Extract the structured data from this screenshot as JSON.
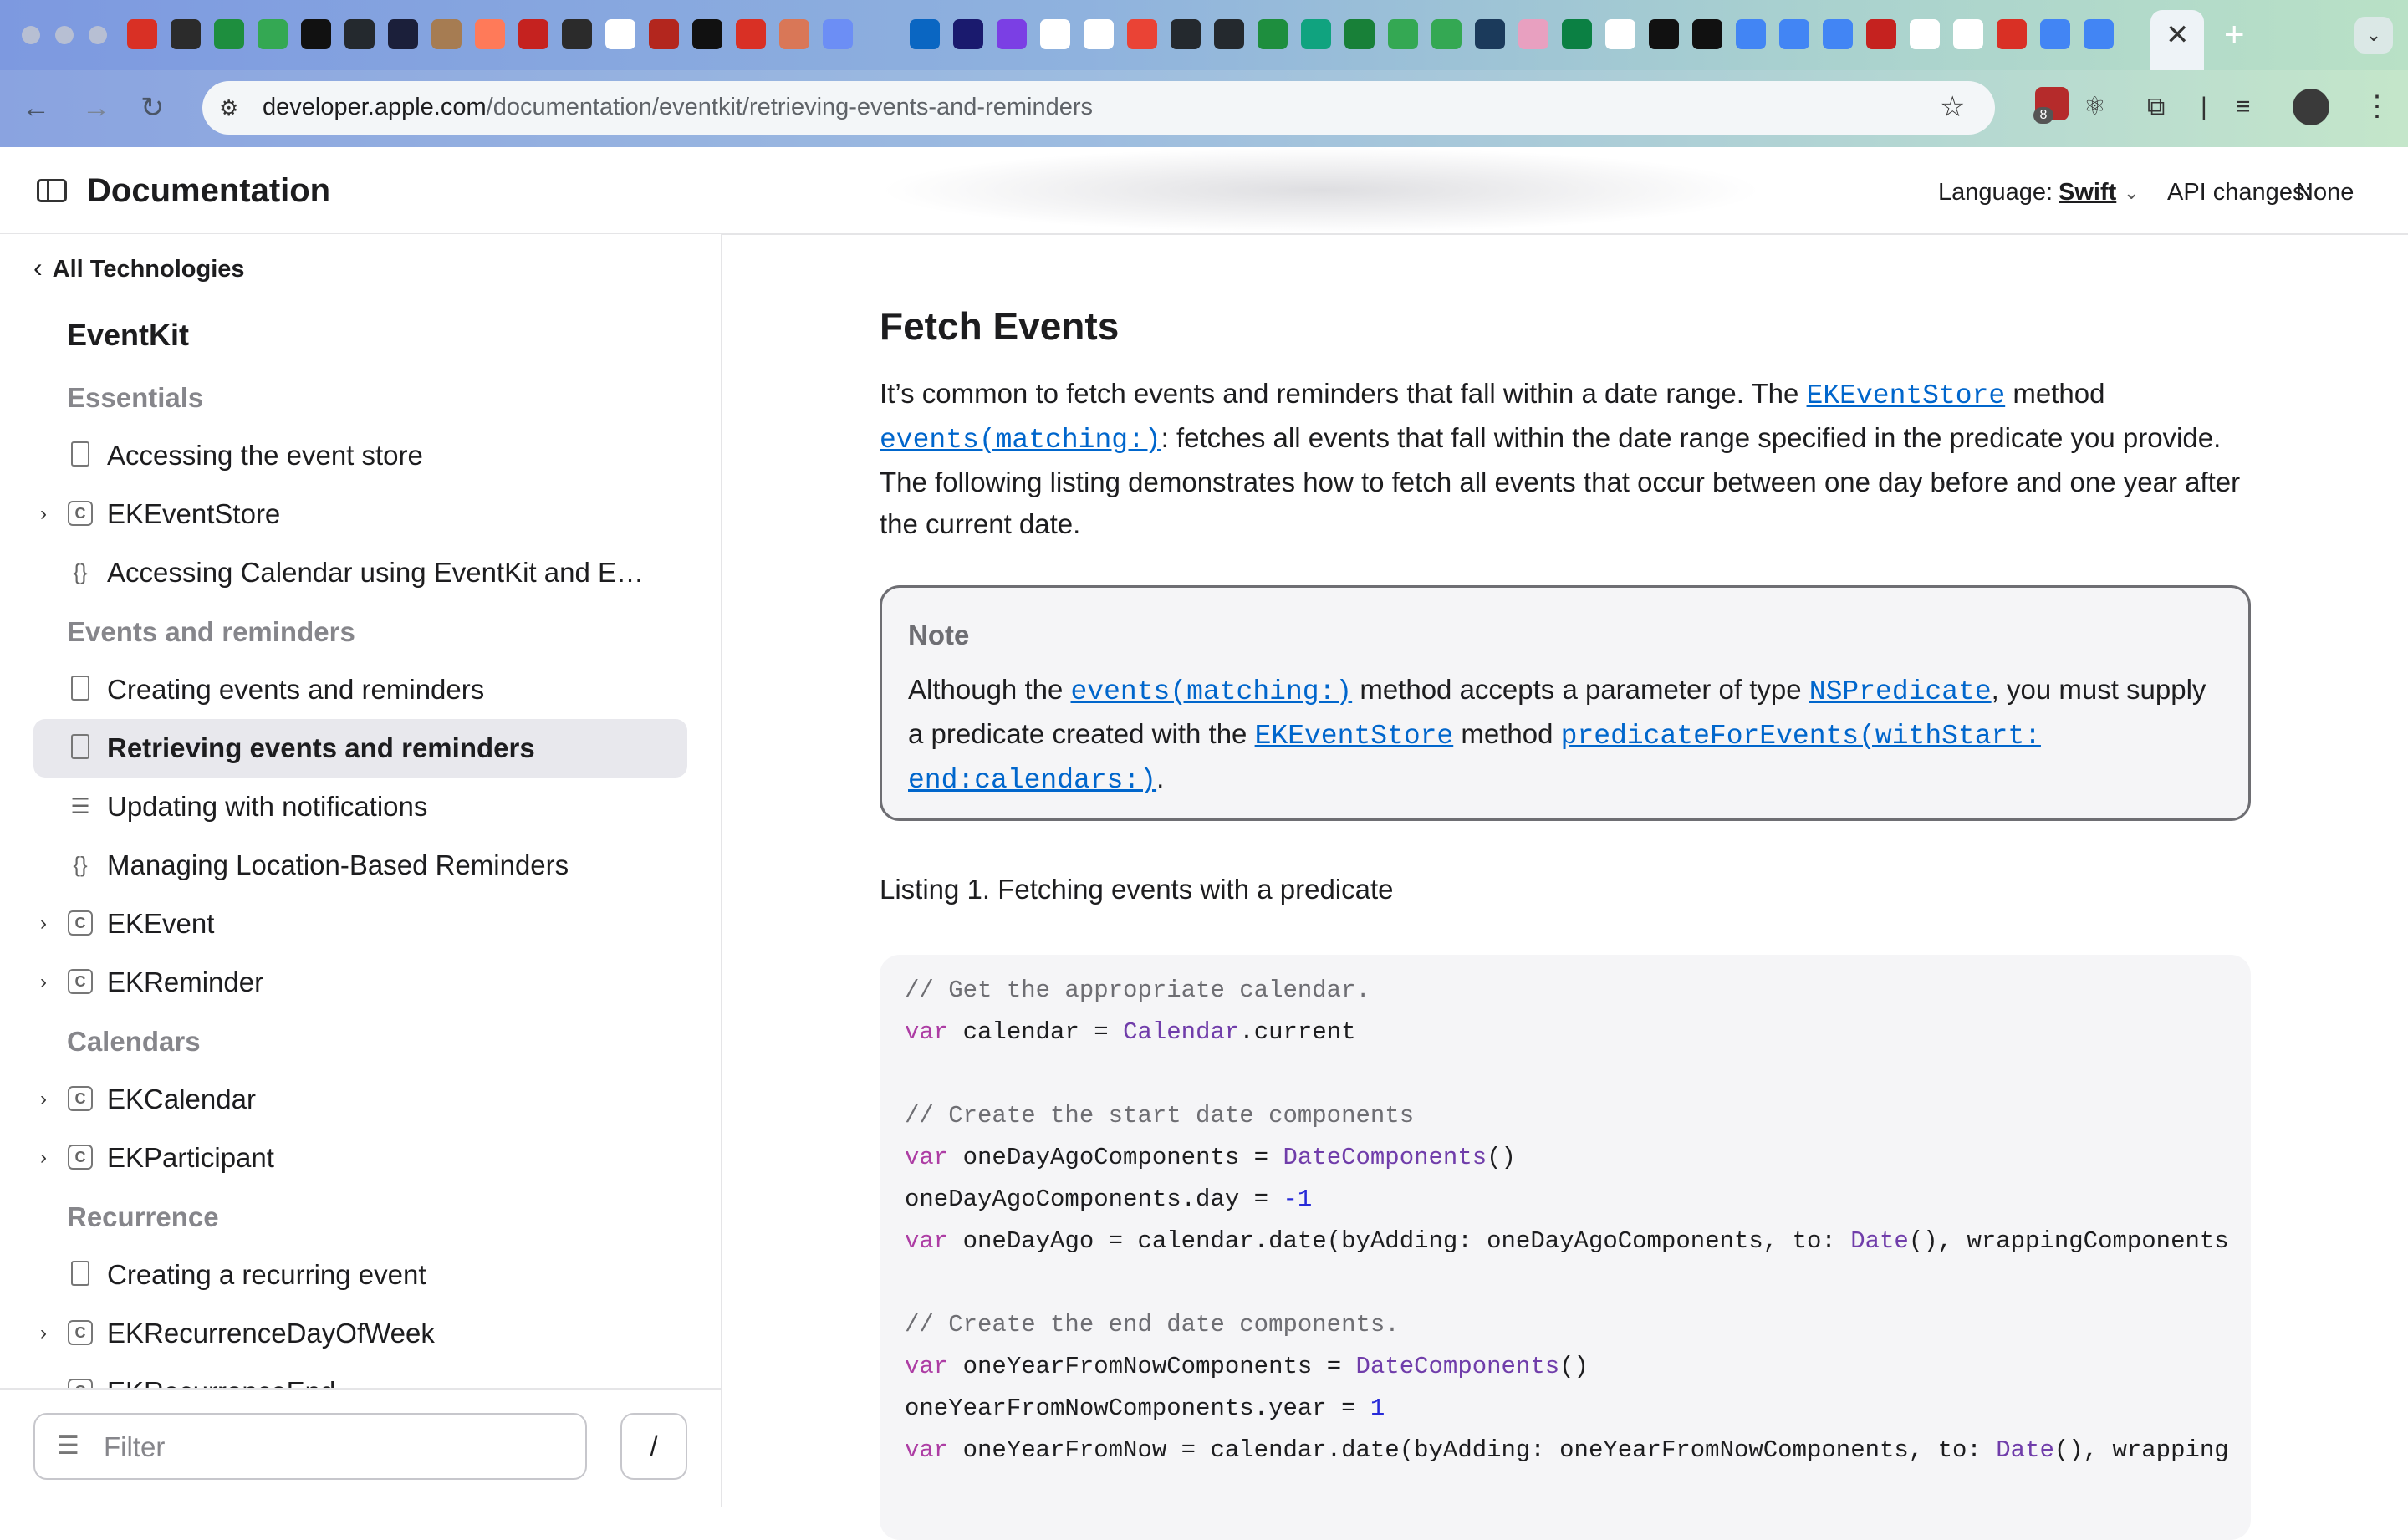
{
  "browser": {
    "url_host": "developer.apple.com",
    "url_path": "/documentation/eventkit/retrieving-events-and-reminders",
    "extension_badge_count": "8",
    "new_tab_glyph": "+",
    "close_tab_glyph": "✕"
  },
  "header": {
    "title": "Documentation",
    "language_label": "Language:",
    "language_value": "Swift",
    "api_changes_label": "API changes:",
    "api_changes_value": "None"
  },
  "sidebar": {
    "back_label": "All Technologies",
    "technology": "EventKit",
    "sections": [
      {
        "title": "Essentials"
      },
      {
        "title": "Events and reminders"
      },
      {
        "title": "Calendars"
      },
      {
        "title": "Recurrence"
      }
    ],
    "items": [
      {
        "label": "Accessing the event store",
        "icon": "article-icon"
      },
      {
        "label": "EKEventStore",
        "icon": "class-icon"
      },
      {
        "label": "Accessing Calendar using EventKit and E…",
        "icon": "sample-code-icon"
      },
      {
        "label": "Creating events and reminders",
        "icon": "article-icon"
      },
      {
        "label": "Retrieving events and reminders",
        "icon": "article-icon"
      },
      {
        "label": "Updating with notifications",
        "icon": "list-icon"
      },
      {
        "label": "Managing Location-Based Reminders",
        "icon": "sample-code-icon"
      },
      {
        "label": "EKEvent",
        "icon": "class-icon"
      },
      {
        "label": "EKReminder",
        "icon": "class-icon"
      },
      {
        "label": "EKCalendar",
        "icon": "class-icon"
      },
      {
        "label": "EKParticipant",
        "icon": "class-icon"
      },
      {
        "label": "Creating a recurring event",
        "icon": "article-icon"
      },
      {
        "label": "EKRecurrenceDayOfWeek",
        "icon": "class-icon"
      },
      {
        "label": "EKRecurrenceEnd",
        "icon": "class-icon"
      }
    ],
    "filter_placeholder": "Filter",
    "filter_shortcut": "/"
  },
  "content": {
    "heading": "Fetch Events",
    "para": {
      "t1": "It’s common to fetch events and reminders that fall within a date range. The ",
      "link1": "EKEventStore",
      "t2": " method ",
      "link2": "events(matching:)",
      "t3": ": fetches all events that fall within the date range specified in the predicate you provide. The following listing demonstrates how to fetch all events that occur between one day before and one year after the current date."
    },
    "note": {
      "title": "Note",
      "t1": "Although the ",
      "link1": "events(matching:)",
      "t2": " method accepts a parameter of type ",
      "link2": "NSPredicate",
      "t3": ", you must supply a predicate created with the ",
      "link3": "EKEventStore",
      "t4": " method ",
      "link4a": "predicateForEvents(withStart:",
      "link4b": "end:calendars:)",
      "t5": "."
    },
    "listing_caption": "Listing 1. Fetching events with a predicate",
    "code": {
      "l1": "// Get the appropriate calendar.",
      "l2_kw": "var",
      "l2_a": " calendar = ",
      "l2_ty": "Calendar",
      "l2_b": ".current",
      "l4": "// Create the start date components",
      "l5_kw": "var",
      "l5_a": " oneDayAgoComponents = ",
      "l5_ty": "DateComponents",
      "l5_b": "()",
      "l6_a": "oneDayAgoComponents.day = ",
      "l6_n": "-1",
      "l7_kw": "var",
      "l7_a": " oneDayAgo = calendar.date(byAdding: oneDayAgoComponents, to: ",
      "l7_ty": "Date",
      "l7_b": "(), wrappingComponents",
      "l9": "// Create the end date components.",
      "l10_kw": "var",
      "l10_a": " oneYearFromNowComponents = ",
      "l10_ty": "DateComponents",
      "l10_b": "()",
      "l11_a": "oneYearFromNowComponents.year = ",
      "l11_n": "1",
      "l12_kw": "var",
      "l12_a": " oneYearFromNow = calendar.date(byAdding: oneYearFromNowComponents, to: ",
      "l12_ty": "Date",
      "l12_b": "(), wrapping"
    }
  }
}
